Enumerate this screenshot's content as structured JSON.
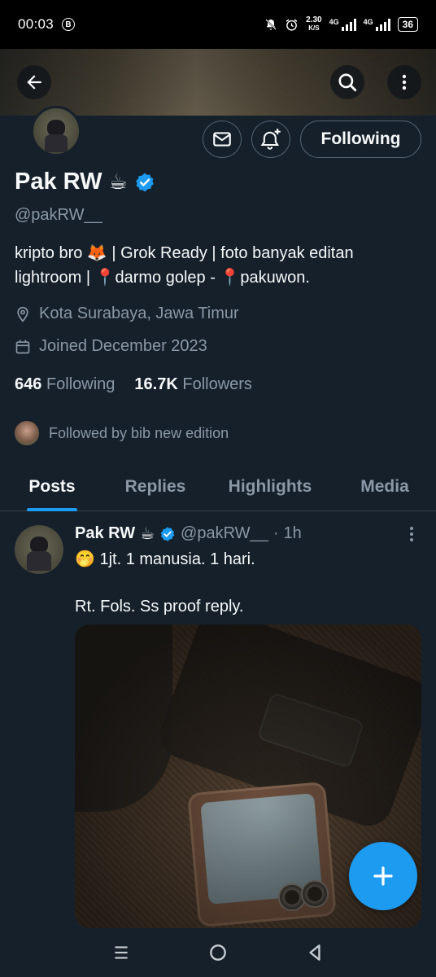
{
  "status_bar": {
    "time": "00:03",
    "notification_badge": "B",
    "speed_value": "2.30",
    "speed_unit": "K/S",
    "net1": "4G",
    "net2": "4G",
    "battery": "36"
  },
  "profile": {
    "name": "Pak RW",
    "name_emoji": "☕",
    "handle": "@pakRW__",
    "bio_line1": "kripto bro 🦊 | Grok Ready | foto banyak editan",
    "bio_line2": "lightroom | 📍darmo golep - 📍pakuwon.",
    "location": "Kota Surabaya, Jawa Timur",
    "joined": "Joined December 2023",
    "following_count": "646",
    "following_label": "Following",
    "followers_count": "16.7K",
    "followers_label": "Followers",
    "followed_by": "Followed by bib new edition",
    "follow_button": "Following"
  },
  "tabs": [
    {
      "label": "Posts",
      "active": true
    },
    {
      "label": "Replies",
      "active": false
    },
    {
      "label": "Highlights",
      "active": false
    },
    {
      "label": "Media",
      "active": false
    }
  ],
  "post": {
    "name": "Pak RW",
    "name_emoji": "☕",
    "handle": "@pakRW__",
    "separator": "·",
    "time": "1h",
    "text": "🤭 1jt. 1 manusia. 1 hari.\n\nRt. Fols. Ss proof reply."
  },
  "colors": {
    "background": "#15202b",
    "accent": "#1d9bf0",
    "muted": "#8b98a5",
    "verified": "#1d9bf0"
  }
}
